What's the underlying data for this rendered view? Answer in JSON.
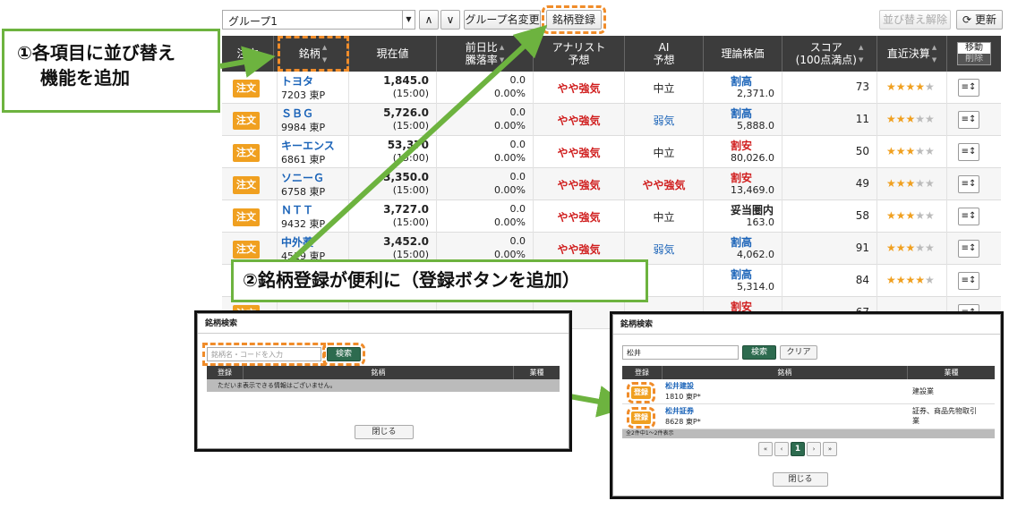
{
  "toolbar": {
    "group": "グループ1",
    "rename": "グループ名変更",
    "register": "銘柄登録",
    "sort_clear": "並び替え解除",
    "refresh": "更新"
  },
  "headers": {
    "order": "注文",
    "name": "銘柄",
    "price": "現在値",
    "change1": "前日比",
    "change2": "騰落率",
    "analyst1": "アナリスト",
    "analyst2": "予想",
    "ai1": "AI",
    "ai2": "予想",
    "theory": "理論株価",
    "score1": "スコア",
    "score2": "(100点満点)",
    "settle": "直近決算",
    "move": "移動",
    "delete": "削除"
  },
  "order_label": "注文",
  "rows": [
    {
      "name": "トヨタ",
      "code": "7203 東P",
      "price": "1,845.0",
      "time": "(15:00)",
      "chg": "0.0",
      "pct": "0.00%",
      "analyst": "やや強気",
      "ai": "中立",
      "theory_label": "割高",
      "theory": "2,371.0",
      "score": "73",
      "stars": 4
    },
    {
      "name": "ＳＢＧ",
      "code": "9984 東P",
      "price": "5,726.0",
      "time": "(15:00)",
      "chg": "0.0",
      "pct": "0.00%",
      "analyst": "やや強気",
      "ai": "弱気",
      "theory_label": "割高",
      "theory": "5,888.0",
      "score": "11",
      "stars": 3
    },
    {
      "name": "キーエンス",
      "code": "6861 東P",
      "price": "53,370",
      "time": "(15:00)",
      "chg": "0.0",
      "pct": "0.00%",
      "analyst": "やや強気",
      "ai": "中立",
      "theory_label": "割安",
      "theory": "80,026.0",
      "score": "50",
      "stars": 3
    },
    {
      "name": "ソニーＧ",
      "code": "6758 東P",
      "price": "3,350.0",
      "time": "(15:00)",
      "chg": "0.0",
      "pct": "0.00%",
      "analyst": "やや強気",
      "ai": "やや強気",
      "theory_label": "割安",
      "theory": "13,469.0",
      "score": "49",
      "stars": 3
    },
    {
      "name": "ＮＴＴ",
      "code": "9432 東P",
      "price": "3,727.0",
      "time": "(15:00)",
      "chg": "0.0",
      "pct": "0.00%",
      "analyst": "やや強気",
      "ai": "中立",
      "theory_label": "妥当圏内",
      "theory": "163.0",
      "score": "58",
      "stars": 3
    },
    {
      "name": "中外薬",
      "code": "4519 東P",
      "price": "3,452.0",
      "time": "(15:00)",
      "chg": "0.0",
      "pct": "0.00%",
      "analyst": "やや強気",
      "ai": "弱気",
      "theory_label": "割高",
      "theory": "4,062.0",
      "score": "91",
      "stars": 3
    },
    {
      "name": "",
      "code": "",
      "price": "",
      "time": "",
      "chg": "",
      "pct": "",
      "analyst": "",
      "ai": "",
      "theory_label": "割高",
      "theory": "5,314.0",
      "score": "84",
      "stars": 4
    },
    {
      "name": "",
      "code": "",
      "price": "",
      "time": "",
      "chg": "",
      "pct": "",
      "analyst": "",
      "ai": "",
      "theory_label": "割安",
      "theory": "",
      "score": "67",
      "stars": 0
    }
  ],
  "callout1": {
    "line1": "①各項目に並び替え",
    "line2": "機能を追加"
  },
  "callout2": "②銘柄登録が便利に（登録ボタンを追加）",
  "dialog_left": {
    "title": "銘柄検索",
    "placeholder": "銘柄名・コードを入力",
    "search": "検索",
    "col_reg": "登録",
    "col_name": "銘柄",
    "col_ind": "業種",
    "empty": "ただいま表示できる情報はございません。",
    "close": "閉じる"
  },
  "dialog_right": {
    "title": "銘柄検索",
    "query": "松井",
    "search": "検索",
    "clear": "クリア",
    "col_reg": "登録",
    "col_name": "銘柄",
    "col_ind": "業種",
    "reg": "登録",
    "results": [
      {
        "name": "松井建設",
        "code": "1810 東P*",
        "ind": "建設業"
      },
      {
        "name": "松井証券",
        "code": "8628 東P*",
        "ind": "証券、商品先物取引業"
      }
    ],
    "count": "全2件中1～2件表示",
    "page": "1",
    "close": "閉じる"
  }
}
